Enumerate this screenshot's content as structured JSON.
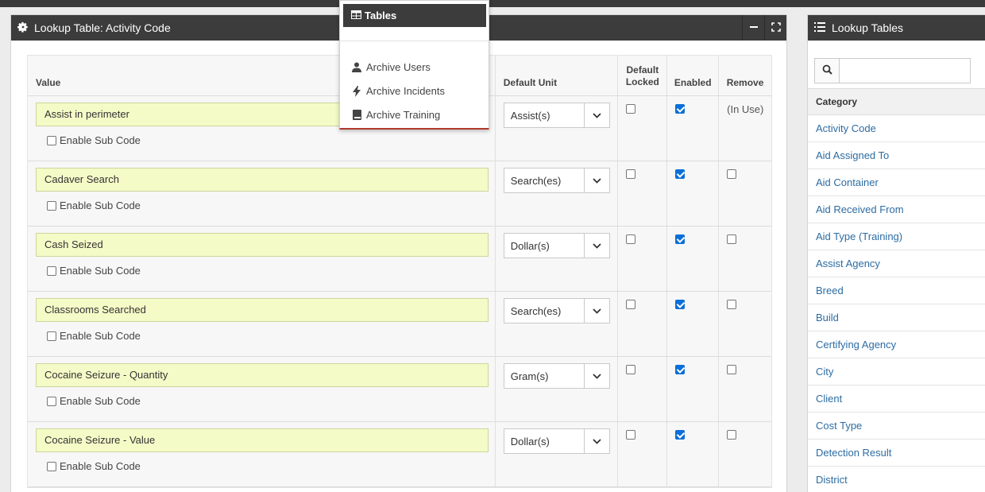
{
  "main_panel": {
    "title": "Lookup Table: Activity Code",
    "icon": "gear-icon",
    "minimize_icon": "minus-icon",
    "maximize_icon": "expand-icon"
  },
  "table": {
    "headers": {
      "value": "Value",
      "default_unit": "Default Unit",
      "default_locked_line1": "Default",
      "default_locked_line2": "Locked",
      "enabled": "Enabled",
      "remove": "Remove"
    },
    "enable_sub_code_label": "Enable Sub Code",
    "rows": [
      {
        "value": "Assist in perimeter",
        "unit": "Assist(s)",
        "default_locked": false,
        "enabled": true,
        "remove_text": "(In Use)",
        "sub_code": false
      },
      {
        "value": "Cadaver Search",
        "unit": "Search(es)",
        "default_locked": false,
        "enabled": true,
        "remove_text": "",
        "sub_code": false
      },
      {
        "value": "Cash Seized",
        "unit": "Dollar(s)",
        "default_locked": false,
        "enabled": true,
        "remove_text": "",
        "sub_code": false
      },
      {
        "value": "Classrooms Searched",
        "unit": "Search(es)",
        "default_locked": false,
        "enabled": true,
        "remove_text": "",
        "sub_code": false
      },
      {
        "value": "Cocaine Seizure - Quantity",
        "unit": "Gram(s)",
        "default_locked": false,
        "enabled": true,
        "remove_text": "",
        "sub_code": false
      },
      {
        "value": "Cocaine Seizure - Value",
        "unit": "Dollar(s)",
        "default_locked": false,
        "enabled": true,
        "remove_text": "",
        "sub_code": false
      }
    ]
  },
  "menu": {
    "header": "Tables",
    "header_icon": "table-icon",
    "items": [
      {
        "label": "Archive Users",
        "icon": "user-icon"
      },
      {
        "label": "Archive Incidents",
        "icon": "bolt-icon"
      },
      {
        "label": "Archive Training",
        "icon": "book-icon"
      }
    ]
  },
  "right_panel": {
    "title": "Lookup Tables",
    "icon": "list-icon",
    "search_icon": "search-icon",
    "search_value": "",
    "category_header": "Category",
    "categories": [
      "Activity Code",
      "Aid Assigned To",
      "Aid Container",
      "Aid Received From",
      "Aid Type (Training)",
      "Assist Agency",
      "Breed",
      "Build",
      "Certifying Agency",
      "City",
      "Client",
      "Cost Type",
      "Detection Result",
      "District"
    ]
  },
  "colors": {
    "header_bg": "#3c3c3c",
    "value_input_bg": "#f5fbc7",
    "link": "#2d6ca2",
    "checkbox_on": "#0a6fd8",
    "menu_accent": "#b03a2e"
  }
}
